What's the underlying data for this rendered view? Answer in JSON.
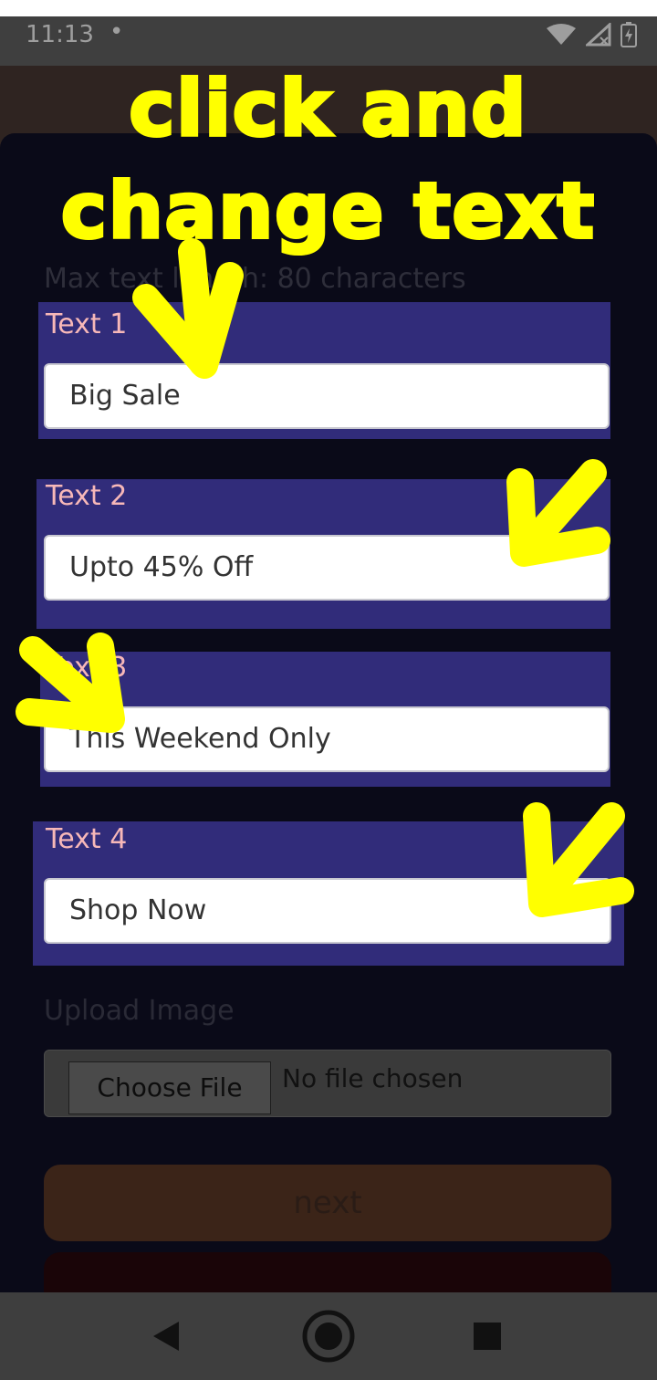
{
  "status_bar": {
    "time": "11:13",
    "dot": "•",
    "icons": [
      "wifi-icon",
      "signal-icon",
      "battery-icon"
    ]
  },
  "overlay": {
    "line1": "click and",
    "line2": "change text",
    "color": "#ffff00"
  },
  "form": {
    "max_length_note": "Max text length: 80 characters",
    "fields": [
      {
        "label": "Text 1",
        "value": "Big Sale"
      },
      {
        "label": "Text 2",
        "value": "Upto 45% Off"
      },
      {
        "label": "Text 3",
        "value": "This Weekend Only"
      },
      {
        "label": "Text 4",
        "value": "Shop Now"
      }
    ],
    "upload_label": "Upload Image",
    "choose_file_label": "Choose File",
    "no_file_text": "No file chosen",
    "next_label": "next"
  },
  "nav_bar": {
    "icons": [
      "back-icon",
      "home-icon",
      "recents-icon"
    ]
  },
  "colors": {
    "highlight": "#312c7a",
    "label": "#f7b8b8",
    "sheet": "#0a0a18"
  }
}
